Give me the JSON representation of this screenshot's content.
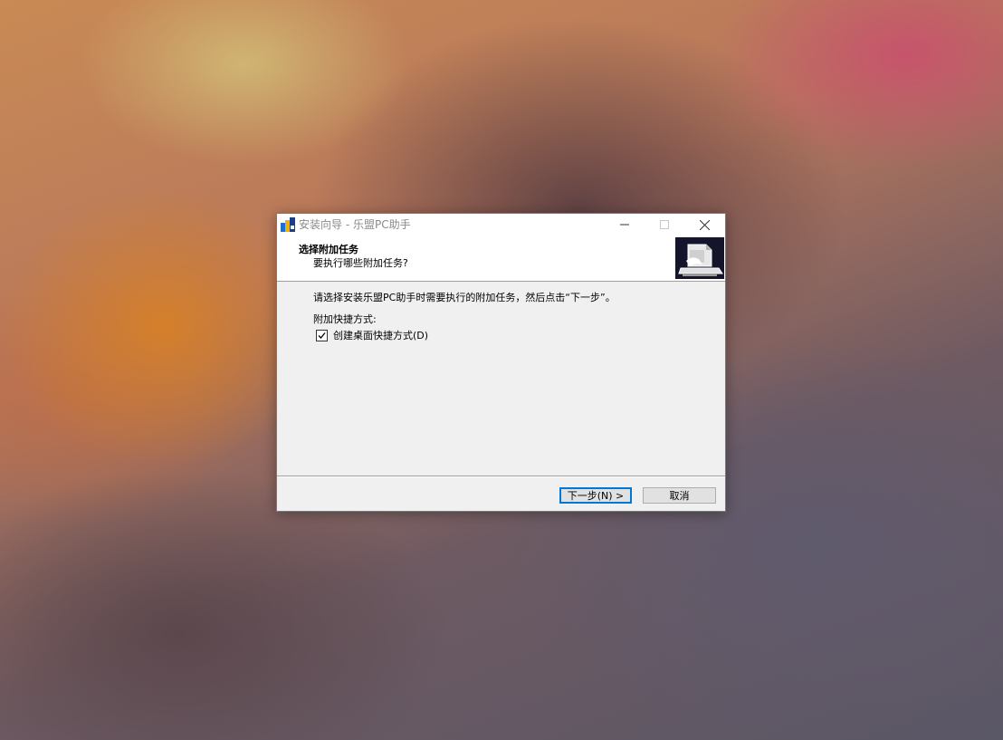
{
  "window": {
    "title": "安装向导 - 乐盟PC助手"
  },
  "header": {
    "title": "选择附加任务",
    "subtitle": "要执行哪些附加任务?"
  },
  "content": {
    "description": "请选择安装乐盟PC助手时需要执行的附加任务，然后点击“下一步”。",
    "group_label": "附加快捷方式:",
    "checkbox": {
      "label": "创建桌面快捷方式(D)",
      "checked": true
    }
  },
  "buttons": {
    "next_label": "下一步(N) >",
    "cancel_label": "取消"
  },
  "icons": {
    "app": "app-icon",
    "header": "installer-box-icon",
    "minimize": "minimize-icon",
    "maximize": "maximize-icon",
    "close": "close-icon",
    "check": "check-icon"
  },
  "colors": {
    "focus_border": "#0078d7",
    "dialog_bg": "#f0f0f0",
    "header_bg": "#ffffff"
  }
}
